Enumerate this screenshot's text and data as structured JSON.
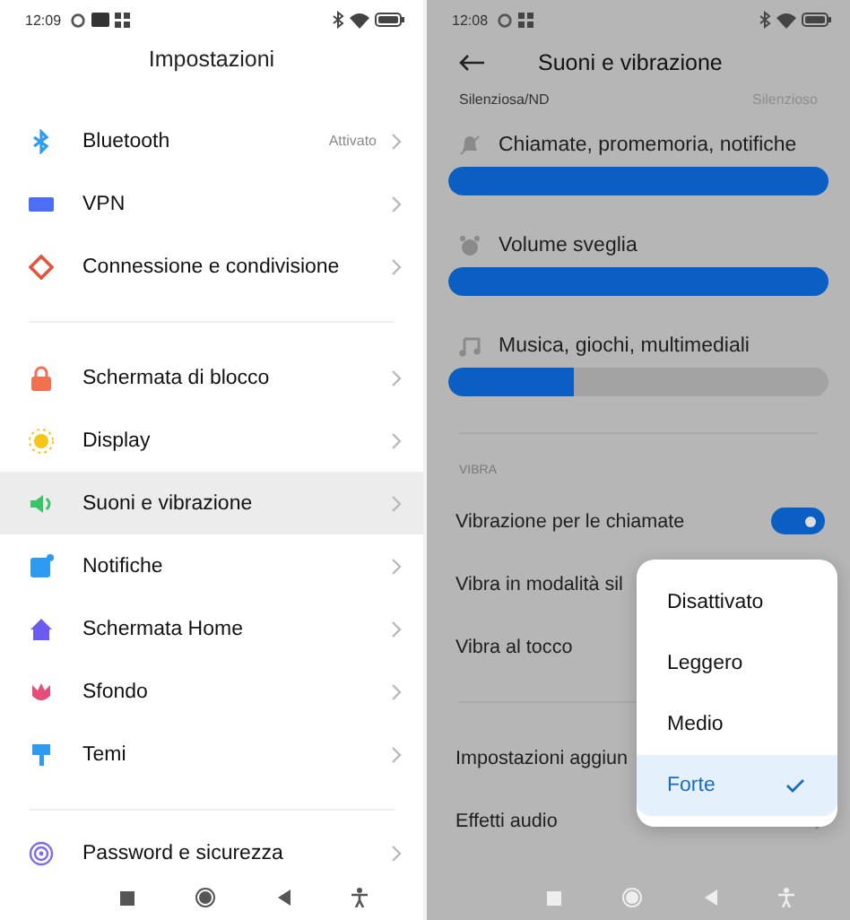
{
  "left": {
    "status_bar": {
      "time": "12:09"
    },
    "title": "Impostazioni",
    "sections": [
      {
        "items": [
          {
            "label": "Bluetooth",
            "value": "Attivato",
            "selected": false
          },
          {
            "label": "VPN",
            "selected": false
          },
          {
            "label": "Connessione e condivisione",
            "selected": false
          }
        ]
      },
      {
        "items": [
          {
            "label": "Schermata di blocco",
            "selected": false
          },
          {
            "label": "Display",
            "selected": false
          },
          {
            "label": "Suoni e vibrazione",
            "selected": true
          },
          {
            "label": "Notifiche",
            "selected": false
          },
          {
            "label": "Schermata Home",
            "selected": false
          },
          {
            "label": "Sfondo",
            "selected": false
          },
          {
            "label": "Temi",
            "selected": false
          }
        ]
      },
      {
        "items": [
          {
            "label": "Password e sicurezza",
            "selected": false
          }
        ]
      }
    ]
  },
  "right": {
    "status_bar": {
      "time": "12:08"
    },
    "title": "Suoni e vibrazione",
    "partial_row": {
      "label": "Silenziosa/ND",
      "value": "Silenzioso"
    },
    "volumes": [
      {
        "label": "Chiamate, promemoria, notifiche",
        "level": 1
      },
      {
        "label": "Volume sveglia",
        "level": 1
      },
      {
        "label": "Musica, giochi, multimediali",
        "level": 0.33
      }
    ],
    "section_header": "VIBRA",
    "rows": [
      {
        "label": "Vibrazione per le chiamate",
        "kind": "toggle",
        "on": true
      },
      {
        "label": "Vibra in modalità sil",
        "kind": "plain"
      },
      {
        "label": "Vibra al tocco",
        "kind": "plain"
      }
    ],
    "rows2": [
      {
        "label": "Impostazioni aggiun",
        "kind": "plain"
      },
      {
        "label": "Effetti audio",
        "kind": "link"
      }
    ],
    "menu": [
      {
        "label": "Disattivato",
        "selected": false
      },
      {
        "label": "Leggero",
        "selected": false
      },
      {
        "label": "Medio",
        "selected": false
      },
      {
        "label": "Forte",
        "selected": true
      }
    ]
  }
}
